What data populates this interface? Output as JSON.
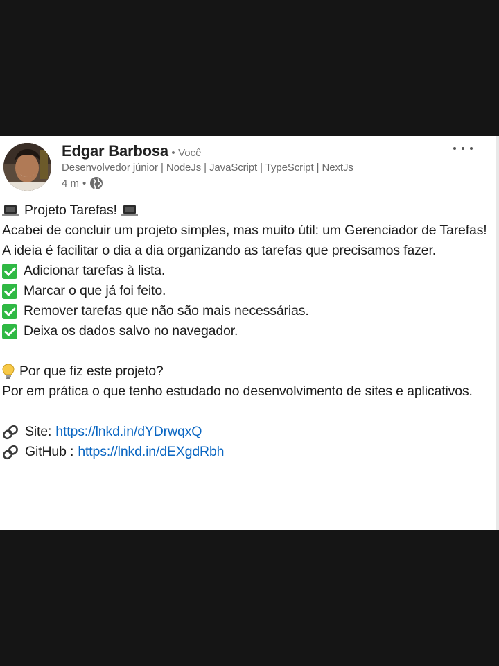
{
  "post": {
    "author": {
      "name": "Edgar Barbosa",
      "separator": "•",
      "degree": "Você",
      "headline": "Desenvolvedor júnior | NodeJs | JavaScript | TypeScript | NextJs",
      "time": "4 m",
      "time_separator": "•",
      "visibility_icon": "globe-icon"
    },
    "more_icon": "more-options-icon",
    "title": "Projeto Tarefas!",
    "intro": "Acabei de concluir um projeto simples, mas muito útil: um Gerenciador de Tarefas! A ideia é facilitar o dia a dia organizando as tarefas que precisamos fazer.",
    "features": [
      "Adicionar tarefas à lista.",
      "Marcar o que já foi feito.",
      "Remover tarefas que não são mais necessárias.",
      "Deixa os dados salvo no navegador."
    ],
    "why_title": "Por que fiz este projeto?",
    "why_text": "Por em prática o que tenho estudado no desenvolvimento de sites e aplicativos.",
    "links": [
      {
        "label": "Site:",
        "url": "https://lnkd.in/dYDrwqxQ"
      },
      {
        "label": "GitHub :",
        "url": "https://lnkd.in/dEXgdRbh"
      }
    ],
    "colors": {
      "link": "#0a66c2",
      "check": "#2fb844",
      "background_outer": "#151515"
    }
  }
}
